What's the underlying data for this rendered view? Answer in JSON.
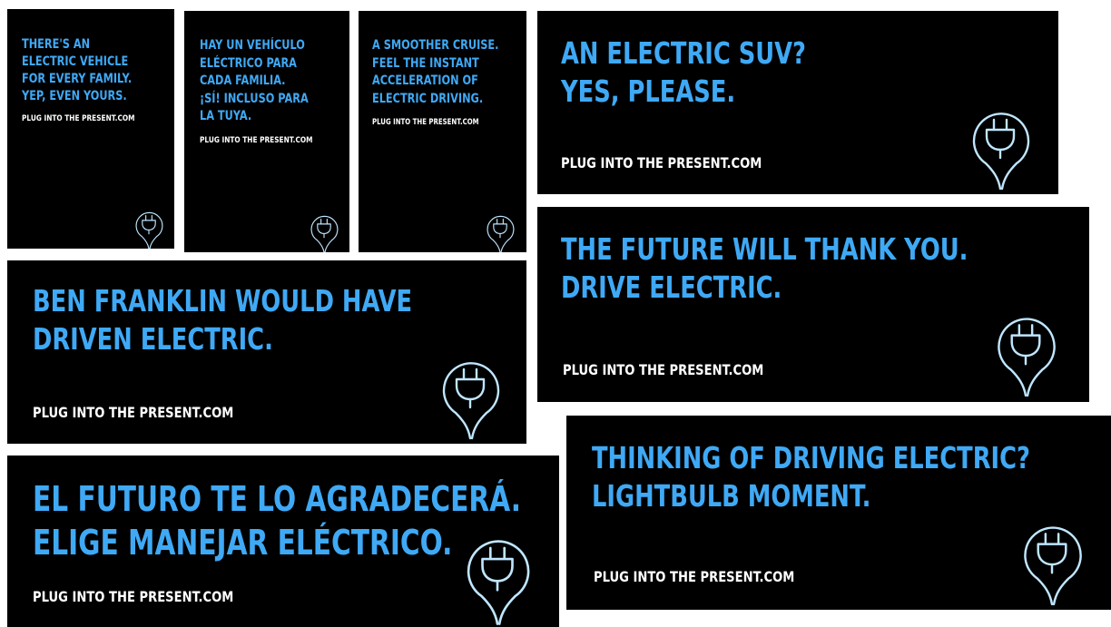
{
  "colors": {
    "background": "#000000",
    "headline": "#3fa9f5",
    "url": "#ffffff",
    "page": "#ffffff"
  },
  "icon": "plug-lightbulb-icon",
  "ads": [
    {
      "lines": [
        "THERE'S AN",
        "ELECTRIC VEHICLE",
        "FOR EVERY FAMILY.",
        "YEP, EVEN YOURS."
      ],
      "url": "PLUG INTO THE PRESENT.COM"
    },
    {
      "lines": [
        "HAY UN VEHÍCULO",
        "ELÉCTRICO PARA",
        "CADA FAMILIA.",
        "¡SÍ! INCLUSO PARA",
        "LA TUYA."
      ],
      "url": "PLUG INTO THE PRESENT.COM"
    },
    {
      "lines": [
        "A SMOOTHER CRUISE.",
        "FEEL THE INSTANT",
        "ACCELERATION OF",
        "ELECTRIC DRIVING."
      ],
      "url": "PLUG INTO THE PRESENT.COM"
    },
    {
      "lines": [
        "AN ELECTRIC SUV?",
        "YES, PLEASE."
      ],
      "url": "PLUG INTO THE PRESENT.COM"
    },
    {
      "lines": [
        "THE FUTURE WILL THANK YOU.",
        "DRIVE ELECTRIC."
      ],
      "url": "PLUG INTO THE PRESENT.COM"
    },
    {
      "lines": [
        "BEN FRANKLIN WOULD HAVE",
        "DRIVEN ELECTRIC."
      ],
      "url": "PLUG INTO THE PRESENT.COM"
    },
    {
      "lines": [
        "THINKING OF DRIVING ELECTRIC?",
        "LIGHTBULB MOMENT."
      ],
      "url": "PLUG INTO THE PRESENT.COM"
    },
    {
      "lines": [
        "EL FUTURO TE LO AGRADECERÁ.",
        "ELIGE MANEJAR ELÉCTRICO."
      ],
      "url": "PLUG INTO THE PRESENT.COM"
    }
  ]
}
